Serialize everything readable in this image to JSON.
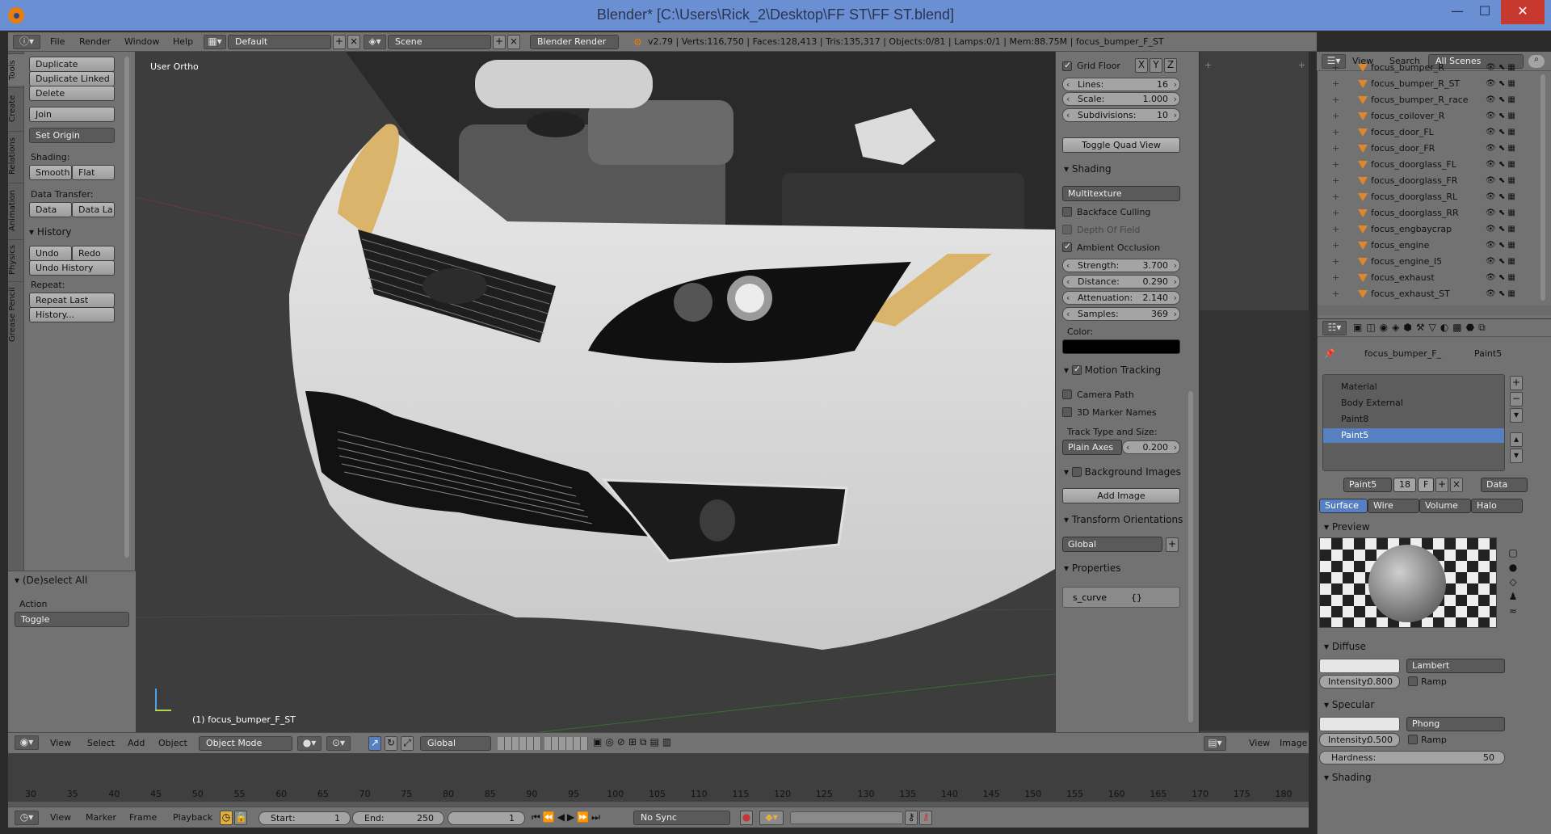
{
  "window": {
    "title": "Blender* [C:\\Users\\Rick_2\\Desktop\\FF ST\\FF ST.blend]",
    "minimize": "—",
    "maximize": "☐",
    "close": "✕"
  },
  "menubar": {
    "menus": [
      "File",
      "Render",
      "Window",
      "Help"
    ],
    "layout": "Default",
    "scene": "Scene",
    "engine": "Blender Render",
    "stats": "v2.79 | Verts:116,750 | Faces:128,413 | Tris:135,317 | Objects:0/81 | Lamps:0/1 | Mem:88.75M | focus_bumper_F_ST"
  },
  "tool_tabs": [
    "Tools",
    "Create",
    "Relations",
    "Animation",
    "Physics",
    "Grease Pencil"
  ],
  "tools": {
    "duplicate": "Duplicate",
    "duplicate_linked": "Duplicate Linked",
    "delete": "Delete",
    "join": "Join",
    "set_origin": "Set Origin",
    "shading_label": "Shading:",
    "smooth": "Smooth",
    "flat": "Flat",
    "data_transfer_label": "Data Transfer:",
    "data": "Data",
    "data_layers": "Data La",
    "history_title": "History",
    "undo": "Undo",
    "redo": "Redo",
    "undo_history": "Undo History",
    "repeat_label": "Repeat:",
    "repeat_last": "Repeat Last",
    "history_btn": "History...",
    "deselect_title": "(De)select All",
    "action_label": "Action",
    "action_value": "Toggle"
  },
  "viewport": {
    "view_name": "User Ortho",
    "object_label": "(1) focus_bumper_F_ST"
  },
  "npanel": {
    "grid_floor": "Grid Floor",
    "axes": [
      "X",
      "Y",
      "Z"
    ],
    "lines_label": "Lines:",
    "lines": "16",
    "scale_label": "Scale:",
    "scale": "1.000",
    "subdiv_label": "Subdivisions:",
    "subdiv": "10",
    "toggle_quad": "Toggle Quad View",
    "shading_title": "Shading",
    "shading_mode": "Multitexture",
    "backface": "Backface Culling",
    "dof": "Depth Of Field",
    "ao": "Ambient Occlusion",
    "strength_label": "Strength:",
    "strength": "3.700",
    "distance_label": "Distance:",
    "distance": "0.290",
    "atten_label": "Attenuation:",
    "atten": "2.140",
    "samples_label": "Samples:",
    "samples": "369",
    "color_label": "Color:",
    "motion_tracking": "Motion Tracking",
    "camera_path": "Camera Path",
    "marker_names": "3D Marker Names",
    "track_type_label": "Track Type and Size:",
    "track_type": "Plain Axes",
    "track_size": "0.200",
    "bg_images": "Background Images",
    "add_image": "Add Image",
    "transform_orient": "Transform Orientations",
    "orient_value": "Global",
    "properties": "Properties",
    "prop_name": "s_curve",
    "prop_value": "{}"
  },
  "outliner": {
    "view": "View",
    "search": "Search",
    "scenes": "All Scenes",
    "items": [
      "focus_bumper_R",
      "focus_bumper_R_ST",
      "focus_bumper_R_race",
      "focus_coilover_R",
      "focus_door_FL",
      "focus_door_FR",
      "focus_doorglass_FL",
      "focus_doorglass_FR",
      "focus_doorglass_RL",
      "focus_doorglass_RR",
      "focus_engbaycrap",
      "focus_engine",
      "focus_engine_I5",
      "focus_exhaust",
      "focus_exhaust_ST"
    ]
  },
  "properties": {
    "breadcrumb_obj": "focus_bumper_F_",
    "breadcrumb_mat": "Paint5",
    "slots": [
      "Material",
      "Body External",
      "Paint8",
      "Paint5"
    ],
    "mat_name": "Paint5",
    "mat_users": "18",
    "mat_fake": "F",
    "data_sel": "Data",
    "tabs": [
      "Surface",
      "Wire",
      "Volume",
      "Halo"
    ],
    "preview": "Preview",
    "diffuse": "Diffuse",
    "diffuse_shader": "Lambert",
    "intensity_label": "Intensity:",
    "diffuse_intensity": "0.800",
    "ramp": "Ramp",
    "specular": "Specular",
    "specular_shader": "Phong",
    "specular_intensity": "0.500",
    "hardness_label": "Hardness:",
    "hardness": "50",
    "shading": "Shading"
  },
  "vpheader": {
    "view": "View",
    "select": "Select",
    "add": "Add",
    "object": "Object",
    "mode": "Object Mode",
    "orient": "Global"
  },
  "imgheader": {
    "view": "View",
    "image": "Image"
  },
  "timeline": {
    "ticks": [
      "30",
      "35",
      "40",
      "45",
      "50",
      "55",
      "60",
      "65",
      "70",
      "75",
      "80",
      "85",
      "90",
      "95",
      "100",
      "105",
      "110",
      "115",
      "120",
      "125",
      "130",
      "135",
      "140",
      "145",
      "150",
      "155",
      "160",
      "165",
      "170",
      "175",
      "180"
    ],
    "view": "View",
    "marker": "Marker",
    "frame": "Frame",
    "playback": "Playback",
    "start_label": "Start:",
    "start": "1",
    "end_label": "End:",
    "end": "250",
    "current": "1",
    "sync": "No Sync"
  },
  "colors": {
    "accent": "#5680c2",
    "orange": "#e87d0d",
    "panel": "#727272"
  }
}
